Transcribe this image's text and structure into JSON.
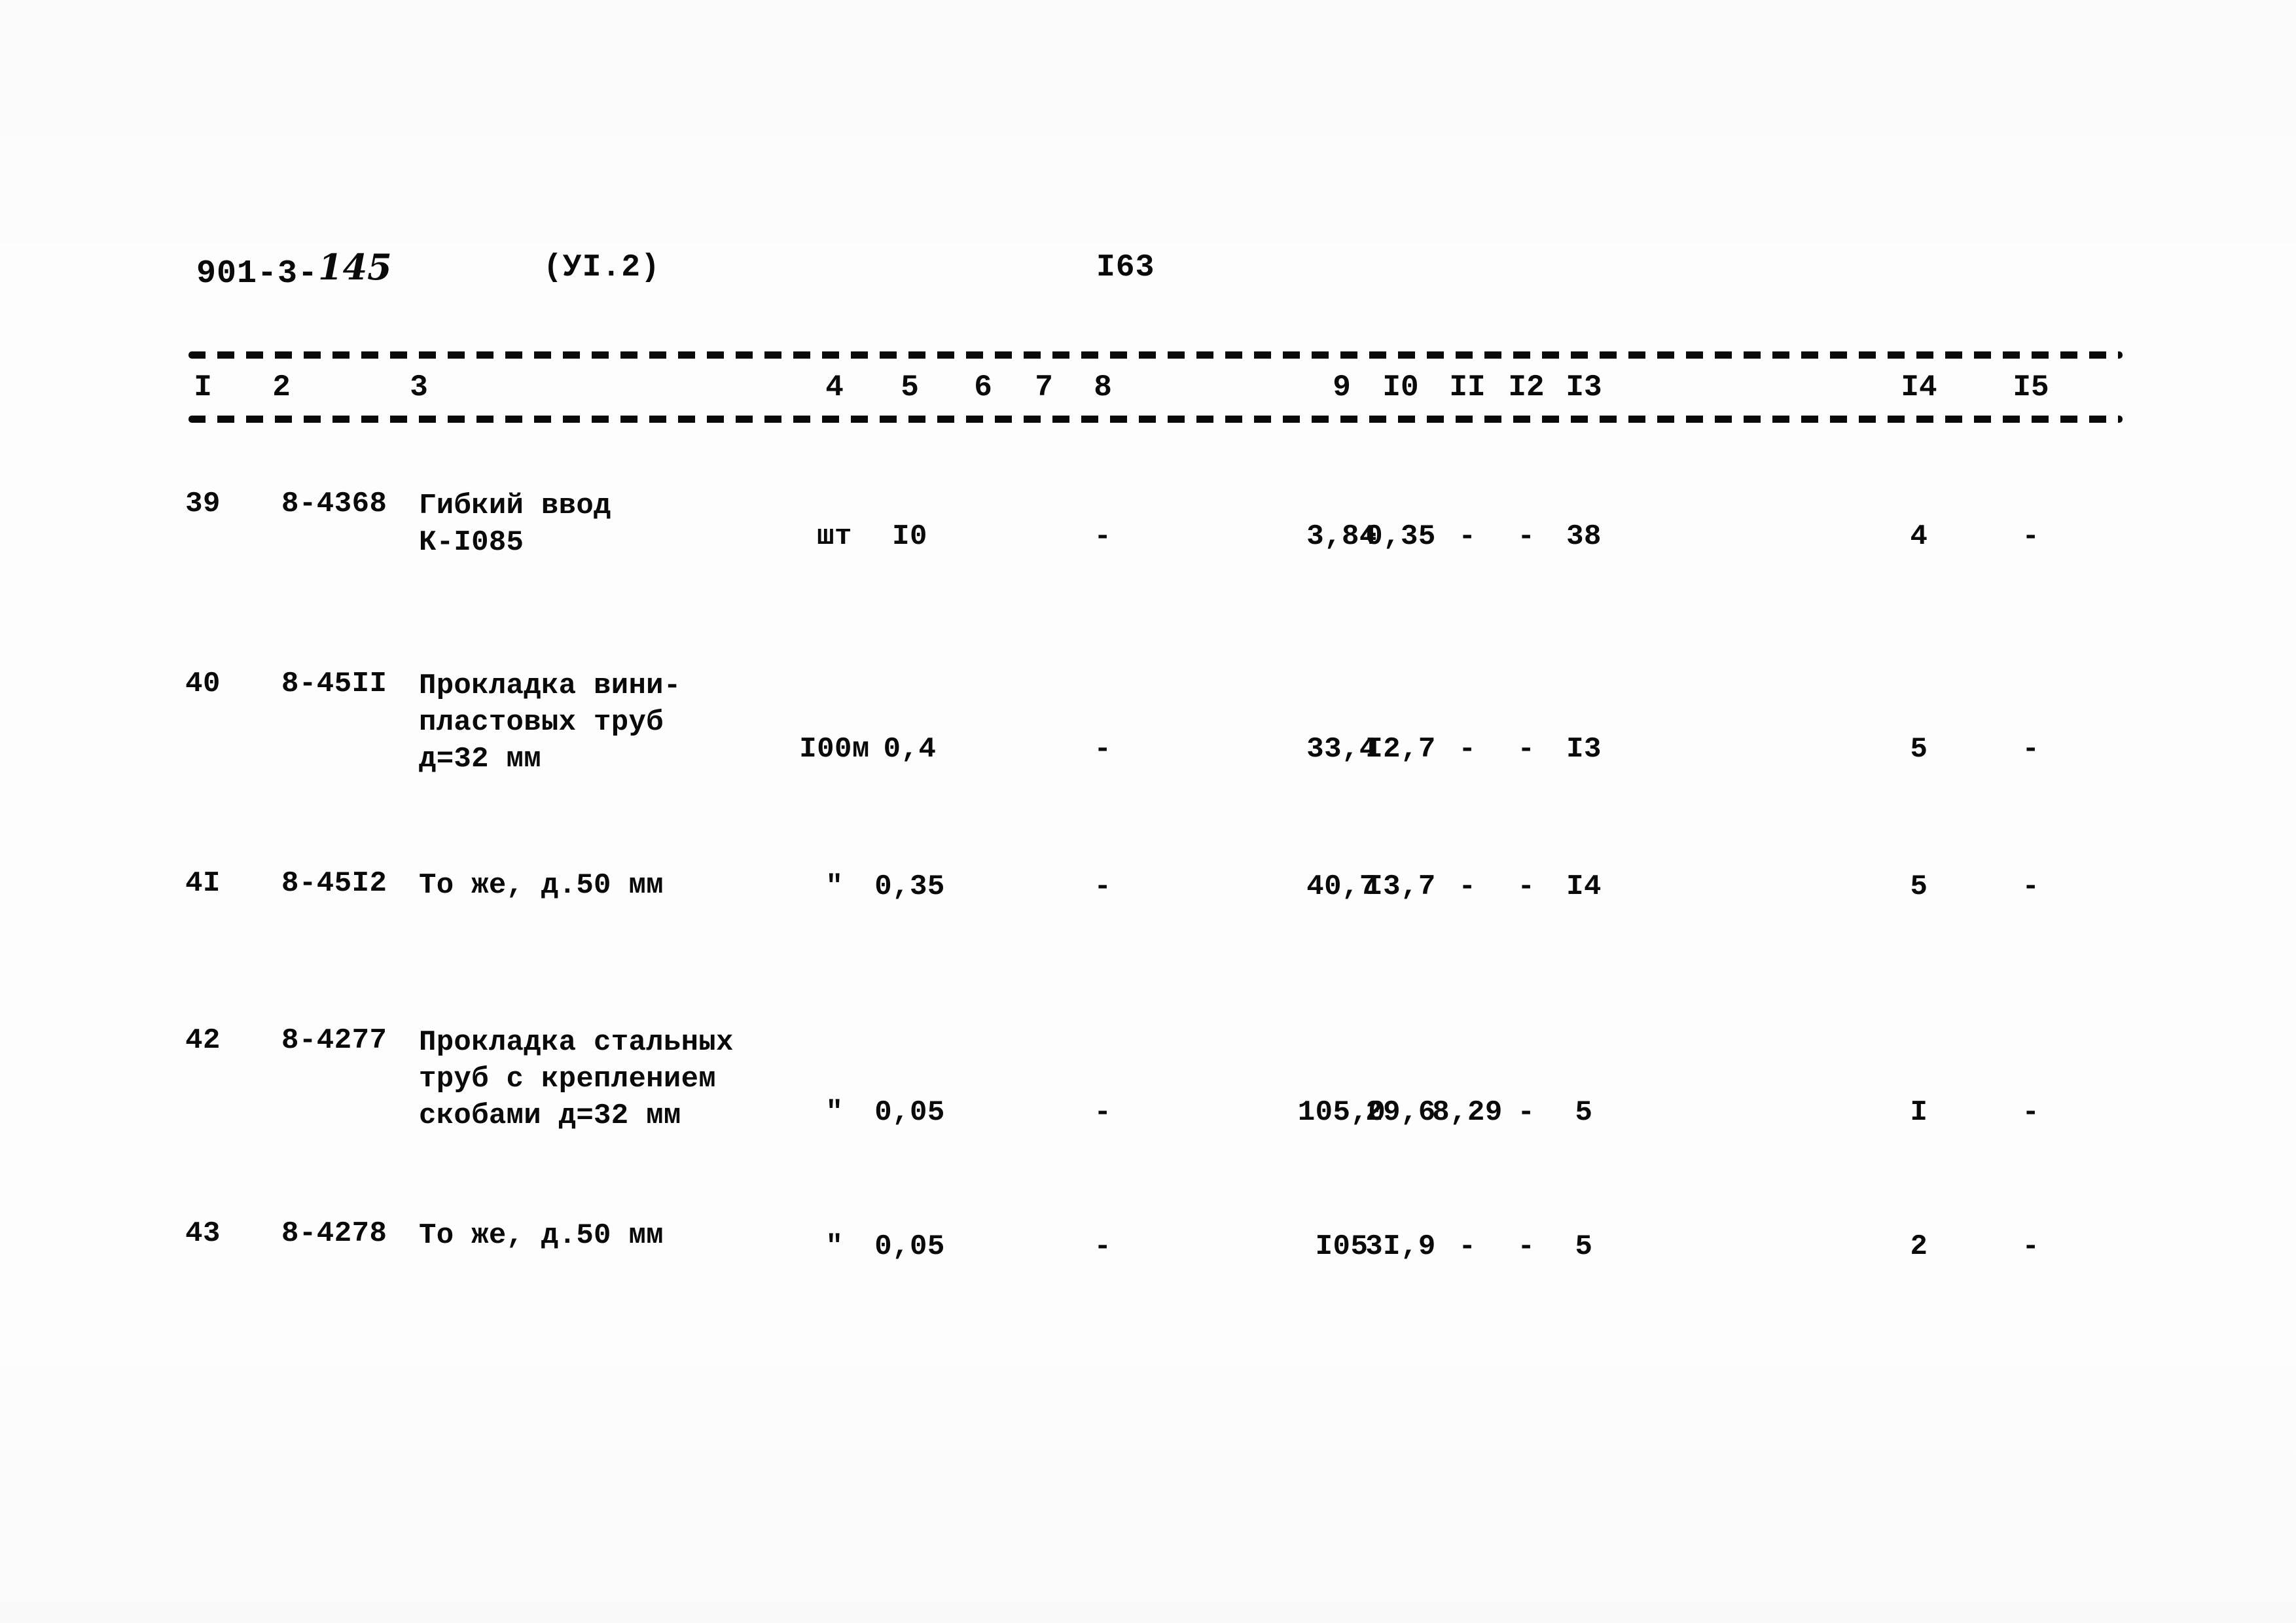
{
  "header": {
    "doc_code_printed": "901-3-",
    "doc_code_handwritten": "145",
    "section": "(УI.2)",
    "page_number": "I63"
  },
  "table": {
    "column_numbers": [
      "I",
      "2",
      "3",
      "4",
      "5",
      "6",
      "7",
      "8",
      "9",
      "I0",
      "II",
      "I2",
      "I3",
      "I4",
      "I5"
    ],
    "rows": [
      {
        "no": "39",
        "code": "8-4368",
        "description_lines": [
          "Гибкий ввод",
          "К-I085"
        ],
        "unit": "шт",
        "qty": "I0",
        "c6": "",
        "c7": "",
        "c8": "-",
        "c9": "3,84",
        "c10": "0,35",
        "c11": "-",
        "c12": "-",
        "c13": "38",
        "c14": "4",
        "c15": "-"
      },
      {
        "no": "40",
        "code": "8-45II",
        "description_lines": [
          "Прокладка вини-",
          "пластовых труб",
          "д=32 мм"
        ],
        "unit": "I00м",
        "qty": "0,4",
        "c6": "",
        "c7": "",
        "c8": "-",
        "c9": "33,4",
        "c10": "I2,7",
        "c11": "-",
        "c12": "-",
        "c13": "I3",
        "c14": "5",
        "c15": "-"
      },
      {
        "no": "4I",
        "code": "8-45I2",
        "description_lines": [
          "То же, д.50 мм"
        ],
        "unit": "\"",
        "qty": "0,35",
        "c6": "",
        "c7": "",
        "c8": "-",
        "c9": "40,7",
        "c10": "I3,7",
        "c11": "-",
        "c12": "-",
        "c13": "I4",
        "c14": "5",
        "c15": "-"
      },
      {
        "no": "42",
        "code": "8-4277",
        "description_lines": [
          "Прокладка стальных",
          "труб с креплением",
          "скобами д=32 мм"
        ],
        "unit": "\"",
        "qty": "0,05",
        "c6": "",
        "c7": "",
        "c8": "-",
        "c9": "105,0",
        "c10": "29,6",
        "c11": "8,29",
        "c12": "-",
        "c13": "5",
        "c14": "I",
        "c15": "-"
      },
      {
        "no": "43",
        "code": "8-4278",
        "description_lines": [
          "То же, д.50 мм"
        ],
        "unit": "\"",
        "qty": "0,05",
        "c6": "",
        "c7": "",
        "c8": "-",
        "c9": "I05",
        "c10": "3I,9",
        "c11": "-",
        "c12": "-",
        "c13": "5",
        "c14": "2",
        "c15": "-"
      }
    ]
  },
  "layout": {
    "col_x": [
      310,
      430,
      640,
      1275,
      1390,
      1502,
      1595,
      1685,
      2050,
      2140,
      2242,
      2332,
      2420,
      2932,
      3103
    ],
    "row_top": [
      745,
      1020,
      1325,
      1565,
      1860
    ],
    "row_value_top": [
      795,
      1120,
      1330,
      1675,
      1880
    ]
  },
  "colors": {
    "ink": "#0a0a0a",
    "paper": "#fdfdfd"
  }
}
